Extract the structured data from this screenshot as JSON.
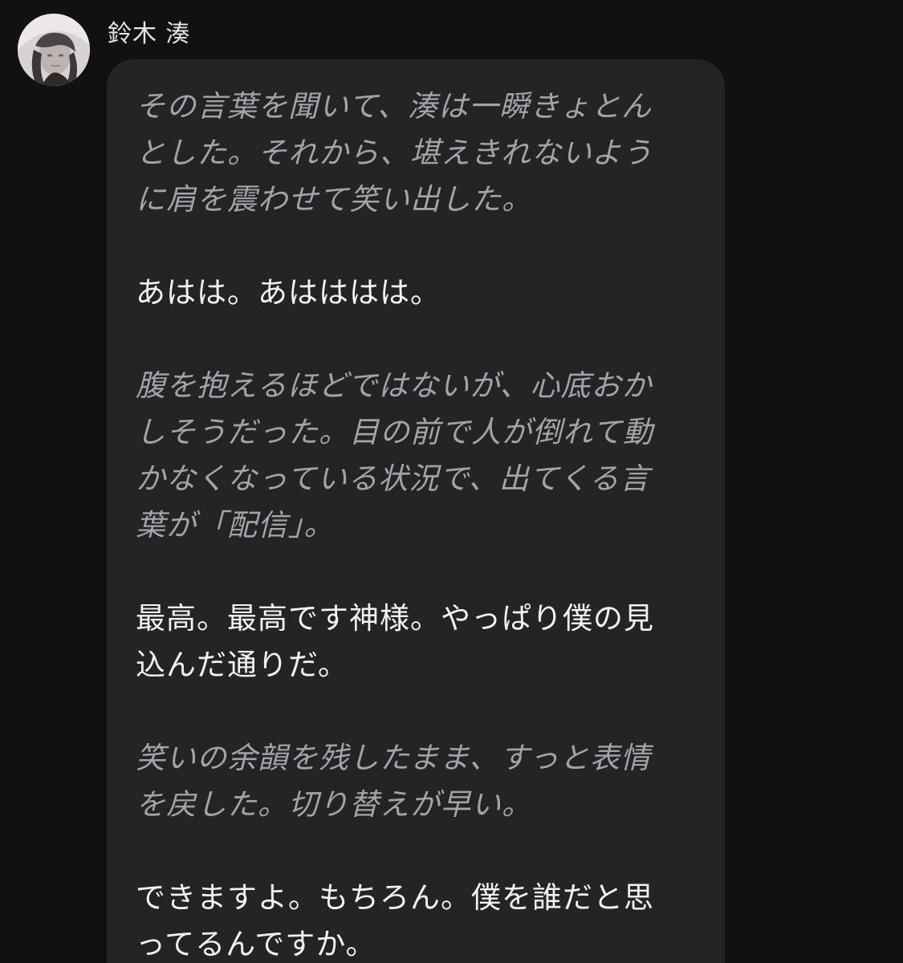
{
  "message": {
    "sender_name": "鈴木 湊",
    "avatar_icon": "character-avatar-icon",
    "paragraphs": [
      {
        "kind": "narration",
        "lines": [
          "その言葉を聞いて、湊は一瞬きょとん",
          "とした。それから、堪えきれないよう",
          "に肩を震わせて笑い出した。"
        ]
      },
      {
        "kind": "speech",
        "lines": [
          "あはは。あはははは。"
        ]
      },
      {
        "kind": "narration",
        "lines": [
          "腹を抱えるほどではないが、心底おか",
          "しそうだった。目の前で人が倒れて動",
          "かなくなっている状況で、出てくる言",
          "葉が「配信」。"
        ]
      },
      {
        "kind": "speech",
        "lines": [
          "最高。最高です神様。やっぱり僕の見",
          "込んだ通りだ。"
        ]
      },
      {
        "kind": "narration",
        "lines": [
          "笑いの余韻を残したまま、すっと表情",
          "を戻した。切り替えが早い。"
        ]
      },
      {
        "kind": "speech",
        "lines": [
          "できますよ。もちろん。僕を誰だと思",
          "ってるんですか。"
        ]
      }
    ]
  },
  "colors": {
    "background": "#111113",
    "bubble": "#242427",
    "speech_text": "#f2f2f2",
    "narration_text": "#a3a3a8",
    "name_text": "#e6e6e6"
  }
}
